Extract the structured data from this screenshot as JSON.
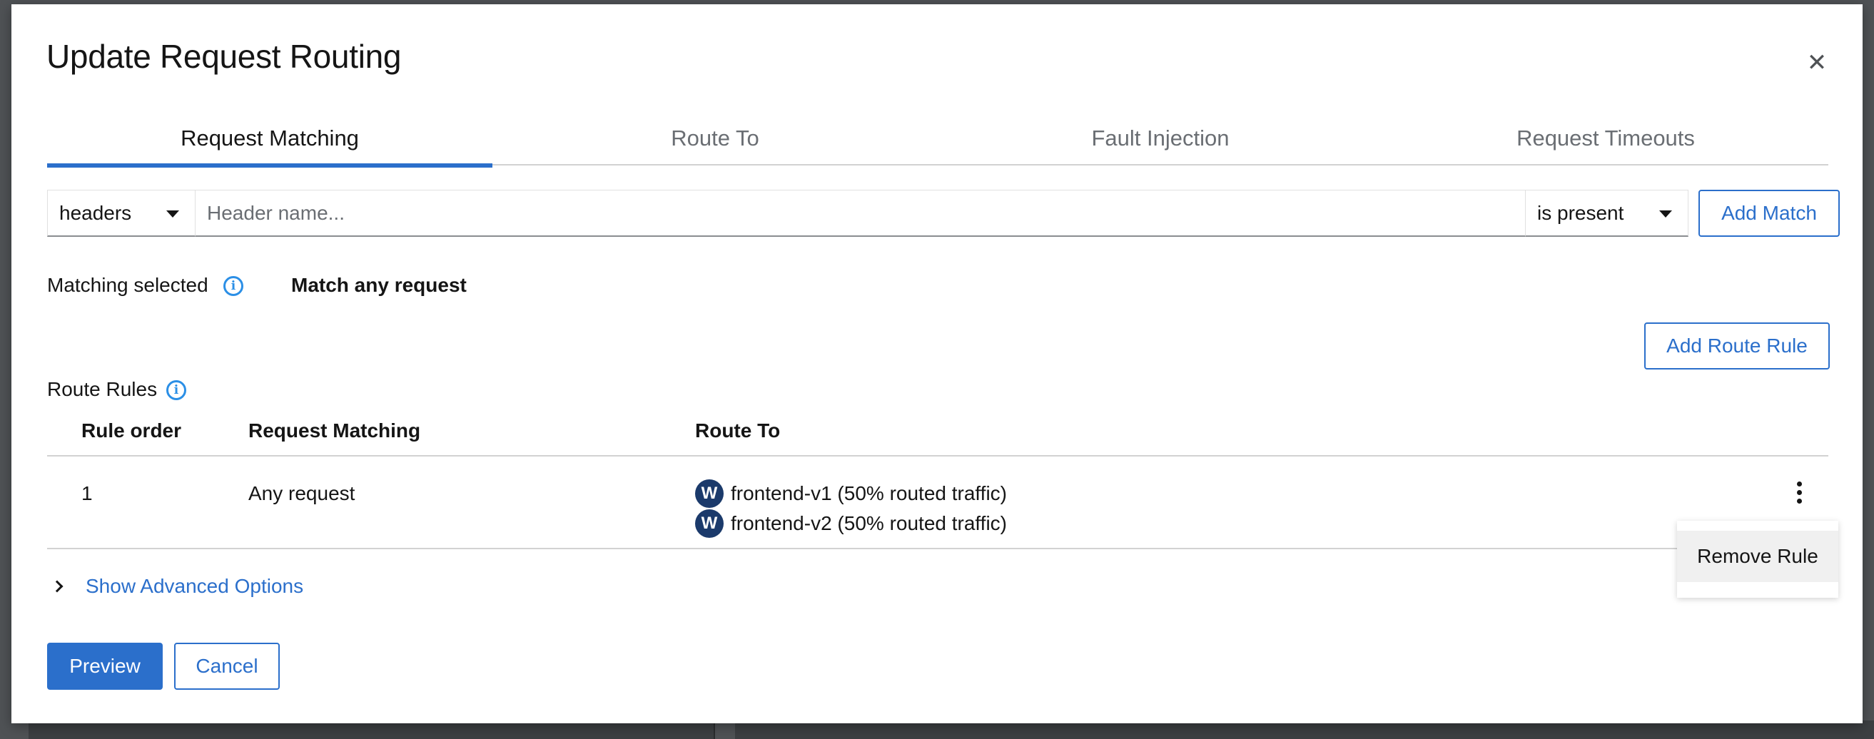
{
  "modal": {
    "title": "Update Request Routing",
    "close_icon": "close-icon"
  },
  "tabs": [
    {
      "label": "Request Matching",
      "active": true
    },
    {
      "label": "Route To",
      "active": false
    },
    {
      "label": "Fault Injection",
      "active": false
    },
    {
      "label": "Request Timeouts",
      "active": false
    }
  ],
  "match": {
    "type_select": "headers",
    "header_placeholder": "Header name...",
    "condition_select": "is present",
    "add_match_label": "Add Match"
  },
  "matching_selected": {
    "label": "Matching selected",
    "value": "Match any request"
  },
  "route_rules": {
    "add_label": "Add Route Rule",
    "label": "Route Rules",
    "columns": [
      "Rule order",
      "Request Matching",
      "Route To"
    ],
    "rows": [
      {
        "order": "1",
        "matching": "Any request",
        "routes": [
          {
            "badge": "W",
            "text": "frontend-v1 (50% routed traffic)"
          },
          {
            "badge": "W",
            "text": "frontend-v2 (50% routed traffic)"
          }
        ]
      }
    ],
    "menu_item": "Remove Rule"
  },
  "advanced_label": "Show Advanced Options",
  "footer": {
    "preview_label": "Preview",
    "cancel_label": "Cancel"
  },
  "colors": {
    "accent": "#2b6fcb",
    "badge": "#1b3a6b",
    "info": "#2b8fe6"
  }
}
